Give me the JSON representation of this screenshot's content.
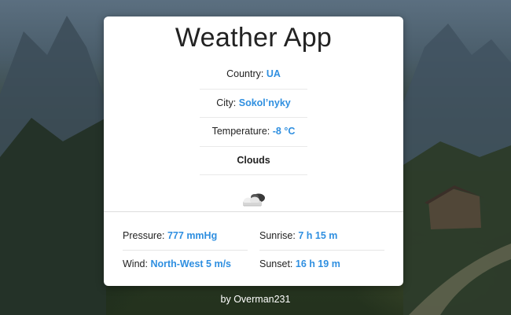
{
  "app": {
    "title": "Weather App"
  },
  "location": {
    "country_label": "Country:",
    "country_value": "UA",
    "city_label": "City:",
    "city_value": "Sokol’nyky",
    "temperature_label": "Temperature:",
    "temperature_value": "-8 °C",
    "condition": "Clouds",
    "condition_icon": "cloud-icon"
  },
  "details": {
    "pressure_label": "Pressure:",
    "pressure_value": "777 mmHg",
    "sunrise_label": "Sunrise:",
    "sunrise_value": "7 h 15 m",
    "wind_label": "Wind:",
    "wind_value": "North-West 5 m/s",
    "sunset_label": "Sunset:",
    "sunset_value": "16 h 19 m"
  },
  "footer": {
    "credit": "by Overman231"
  },
  "colors": {
    "accent": "#2f8fe0",
    "card": "#ffffff",
    "text": "#222222"
  }
}
